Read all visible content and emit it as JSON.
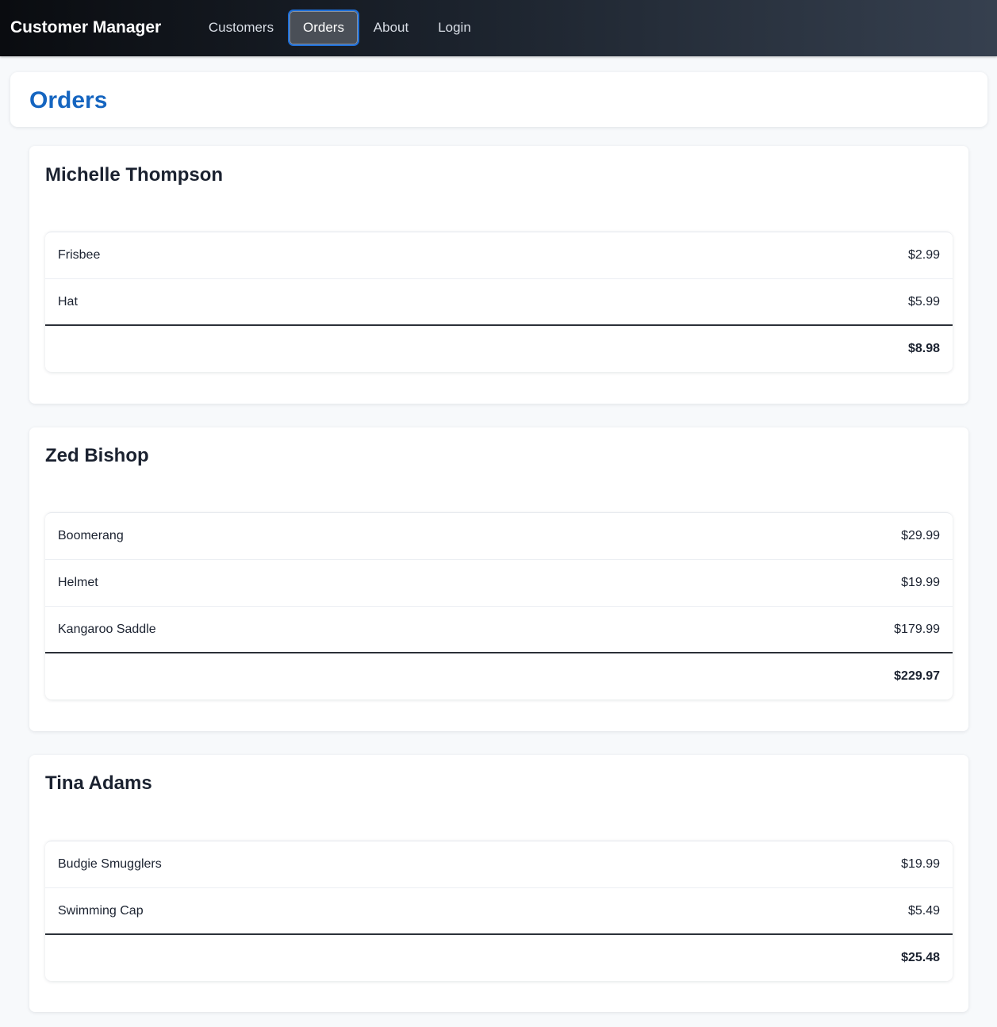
{
  "app": {
    "brand": "Customer Manager",
    "nav": [
      {
        "label": "Customers",
        "active": false
      },
      {
        "label": "Orders",
        "active": true
      },
      {
        "label": "About",
        "active": false
      },
      {
        "label": "Login",
        "active": false
      }
    ]
  },
  "page": {
    "title": "Orders"
  },
  "customers": [
    {
      "name": "Michelle Thompson",
      "items": [
        {
          "name": "Frisbee",
          "price": "$2.99"
        },
        {
          "name": "Hat",
          "price": "$5.99"
        }
      ],
      "total": "$8.98"
    },
    {
      "name": "Zed Bishop",
      "items": [
        {
          "name": "Boomerang",
          "price": "$29.99"
        },
        {
          "name": "Helmet",
          "price": "$19.99"
        },
        {
          "name": "Kangaroo Saddle",
          "price": "$179.99"
        }
      ],
      "total": "$229.97"
    },
    {
      "name": "Tina Adams",
      "items": [
        {
          "name": "Budgie Smugglers",
          "price": "$19.99"
        },
        {
          "name": "Swimming Cap",
          "price": "$5.49"
        }
      ],
      "total": "$25.48"
    }
  ],
  "colors": {
    "accent": "#1565c0",
    "active_border": "#1e6fd9",
    "page_bg": "#f7f9fb"
  }
}
